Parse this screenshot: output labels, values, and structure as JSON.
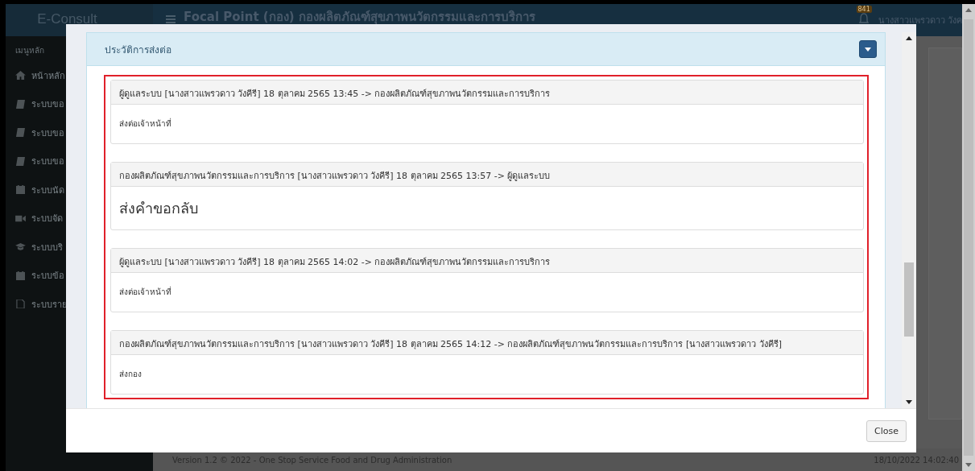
{
  "app": {
    "brand": "E-Consult",
    "title": "Focal Point (กอง) กองผลิตภัณฑ์สุขภาพนวัตกรรมและการบริการ",
    "notification_count": "841",
    "user": "นางสาวแพรวดาว วังค"
  },
  "sidebar": {
    "heading": "เมนูหลัก",
    "items": [
      {
        "label": "หน้าหลัก",
        "kind": "home"
      },
      {
        "label": "ระบบขอ",
        "kind": "book"
      },
      {
        "label": "ระบบขอ",
        "kind": "book"
      },
      {
        "label": "ระบบขอ",
        "kind": "book"
      },
      {
        "label": "ระบบนัด",
        "kind": "calendar"
      },
      {
        "label": "ระบบจัด",
        "kind": "video"
      },
      {
        "label": "ระบบบริ",
        "kind": "cap"
      },
      {
        "label": "ระบบข้อ",
        "kind": "calendar"
      },
      {
        "label": "ระบบราย",
        "kind": "file"
      }
    ]
  },
  "footer": {
    "version": "Version 1.2 © 2022 - One Stop Service Food and Drug Administration",
    "timestamp": "18/10/2022 14:02:40"
  },
  "modal": {
    "panel_title": "ประวัติการส่งต่อ",
    "entries": [
      {
        "header": "ผู้ดูแลระบบ [นางสาวแพรวดาว วังคีรี] 18 ตุลาคม 2565 13:45 -> กองผลิตภัณฑ์สุขภาพนวัตกรรมและการบริการ",
        "body": "ส่งต่อเจ้าหน้าที่",
        "kind": "text"
      },
      {
        "header": "กองผลิตภัณฑ์สุขภาพนวัตกรรมและการบริการ [นางสาวแพรวดาว วังคีรี] 18 ตุลาคม 2565 13:57 -> ผู้ดูแลระบบ",
        "body": "ส่งคำขอกลับ",
        "kind": "heading"
      },
      {
        "header": "ผู้ดูแลระบบ [นางสาวแพรวดาว วังคีรี] 18 ตุลาคม 2565 14:02 -> กองผลิตภัณฑ์สุขภาพนวัตกรรมและการบริการ",
        "body": "ส่งต่อเจ้าหน้าที่",
        "kind": "text"
      },
      {
        "header": "กองผลิตภัณฑ์สุขภาพนวัตกรรมและการบริการ [นางสาวแพรวดาว วังคีรี] 18 ตุลาคม 2565 14:12 -> กองผลิตภัณฑ์สุขภาพนวัตกรรมและการบริการ [นางสาวแพรวดาว วังคีรี]",
        "body": "ส่งกอง",
        "kind": "text"
      }
    ],
    "close_button": "Close"
  }
}
